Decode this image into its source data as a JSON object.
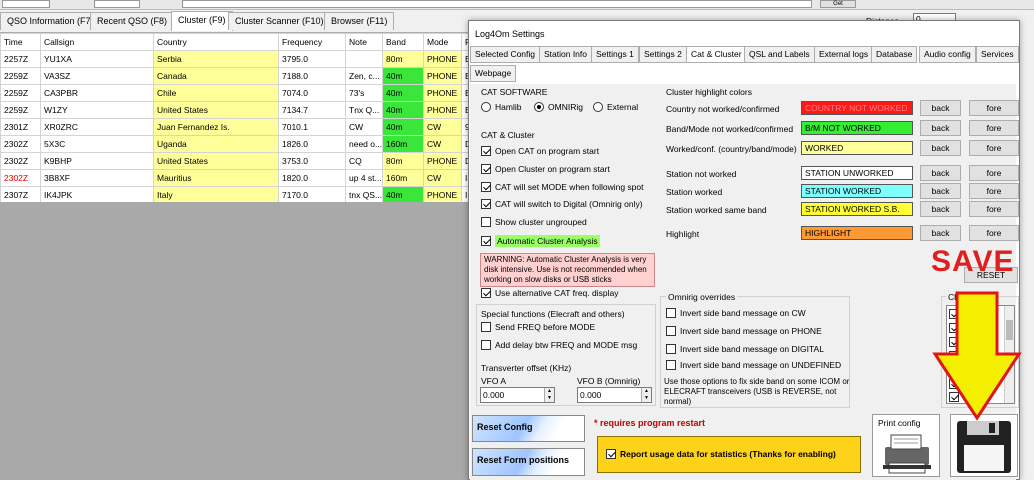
{
  "main_tabs": [
    "QSO Information (F7)",
    "Recent QSO (F8)",
    "Cluster (F9)",
    "Cluster Scanner (F10)",
    "Browser (F11)"
  ],
  "top_controls": {
    "get_label": "Get",
    "distance_label": "Distance",
    "distance_value": "0"
  },
  "grid": {
    "headers": [
      "Time",
      "Callsign",
      "Country",
      "Frequency",
      "Note",
      "Band",
      "Mode",
      "F"
    ],
    "rows": [
      {
        "time": "2257Z",
        "call": "YU1XA",
        "country": "Serbia",
        "freq": "3795.0",
        "note": "",
        "band": "80m",
        "mode": "PHONE",
        "f": "E"
      },
      {
        "time": "2259Z",
        "call": "VA3SZ",
        "country": "Canada",
        "freq": "7188.0",
        "note": "Zen, c...",
        "band": "40m",
        "mode": "PHONE",
        "f": "E"
      },
      {
        "time": "2259Z",
        "call": "CA3PBR",
        "country": "Chile",
        "freq": "7074.0",
        "note": "73's",
        "band": "40m",
        "mode": "PHONE",
        "f": "E"
      },
      {
        "time": "2259Z",
        "call": "W1ZY",
        "country": "United States",
        "freq": "7134.7",
        "note": "Tnx Q...",
        "band": "40m",
        "mode": "PHONE",
        "f": "E"
      },
      {
        "time": "2301Z",
        "call": "XR0ZRC",
        "country": "Juan Fernandez Is.",
        "freq": "7010.1",
        "note": "CW",
        "band": "40m",
        "mode": "CW",
        "f": "9"
      },
      {
        "time": "2302Z",
        "call": "5X3C",
        "country": "Uganda",
        "freq": "1826.0",
        "note": "need o...",
        "band": "160m",
        "mode": "CW",
        "f": "D"
      },
      {
        "time": "2302Z",
        "call": "K9BHP",
        "country": "United States",
        "freq": "3753.0",
        "note": "CQ",
        "band": "80m",
        "mode": "PHONE",
        "f": "D"
      },
      {
        "time": "2302Z",
        "call": "3B8XF",
        "country": "Mauritius",
        "freq": "1820.0",
        "note": "up 4 st...",
        "band": "160m",
        "mode": "CW",
        "f": "I"
      },
      {
        "time": "2307Z",
        "call": "IK4JPK",
        "country": "Italy",
        "freq": "7170.0",
        "note": "tnx QS...",
        "band": "40m",
        "mode": "PHONE",
        "f": "I"
      }
    ]
  },
  "dialog": {
    "title": "Log4Om Settings",
    "tabs": [
      "Selected Config",
      "Station Info",
      "Settings 1",
      "Settings 2",
      "Cat & Cluster",
      "QSL and Labels",
      "External logs",
      "Database",
      "Audio config",
      "Services",
      "Webpage"
    ],
    "cat_software": {
      "title": "CAT SOFTWARE",
      "options": [
        "Hamlib",
        "OMNIRig",
        "External"
      ]
    },
    "cat_cluster": {
      "title": "CAT & Cluster",
      "items": [
        "Open CAT on program start",
        "Open Cluster on program start",
        "CAT will set MODE when following spot",
        "CAT will switch to Digital (Omnirig only)",
        "Show cluster ungrouped",
        "Automatic Cluster Analysis"
      ]
    },
    "warning": "WARNING: Automatic Cluster Analysis is very disk intensive. Use is not recommended when working on slow disks or USB sticks",
    "alt_cat": "Use alternative CAT freq. display",
    "special": {
      "title": "Special functions (Elecraft and others)",
      "items": [
        "Send FREQ before MODE",
        "Add delay btw FREQ and MODE msg"
      ]
    },
    "transverter": {
      "title": "Transverter offset (KHz)",
      "vfo_a_label": "VFO A",
      "vfo_b_label": "VFO B (Omnirig)",
      "vfo_a": "0.000",
      "vfo_b": "0.000"
    },
    "highlight": {
      "title": "Cluster highlight colors",
      "back_label": "back",
      "fore_label": "fore",
      "rows": [
        {
          "label": "Country not worked/confirmed",
          "swatch": "COUNTRY NOT WORKED",
          "bg": "#ff1a1a",
          "fg": "#ff8080"
        },
        {
          "label": "Band/Mode not worked/confirmed",
          "swatch": "B/M NOT WORKED",
          "bg": "#33ee33",
          "fg": "#000000"
        },
        {
          "label": "Worked/conf. (country/band/mode)",
          "swatch": "WORKED",
          "bg": "#ffff99",
          "fg": "#000000"
        },
        {
          "label": "Station not worked",
          "swatch": "STATION UNWORKED",
          "bg": "#ffffff",
          "fg": "#000000"
        },
        {
          "label": "Station worked",
          "swatch": "STATION WORKED",
          "bg": "#80ffff",
          "fg": "#000000"
        },
        {
          "label": "Station worked same band",
          "swatch": "STATION WORKED S.B.",
          "bg": "#ffff33",
          "fg": "#000000"
        },
        {
          "label": "Highlight",
          "swatch": "HIGHLIGHT",
          "bg": "#ff9933",
          "fg": "#000000"
        }
      ]
    },
    "reset_label": "RESET",
    "omnirig": {
      "title": "Omnirig overrides",
      "items": [
        "Invert side band message on CW",
        "Invert side band message on PHONE",
        "Invert side band message on DIGITAL",
        "Invert side band message on UNDEFINED"
      ],
      "note": "Use those options to fix side band on some ICOM or ELECRAFT transceivers (USB is REVERSE, not normal)"
    },
    "cluster_list_title": "Clu",
    "reset_config": "Reset Config",
    "reset_forms": "Reset Form positions",
    "restart_note": "* requires program restart",
    "usage": "Report usage data for statistics (Thanks for enabling)",
    "print_config": "Print config"
  },
  "annotation": {
    "save": "SAVE"
  }
}
